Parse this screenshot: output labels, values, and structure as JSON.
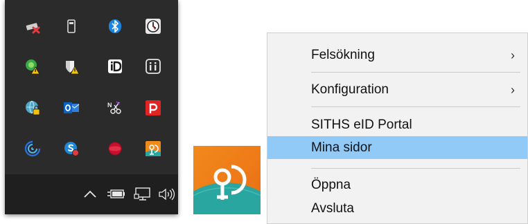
{
  "tray": {
    "icons": [
      {
        "name": "safely-remove-drive-icon"
      },
      {
        "name": "usb-drive-icon"
      },
      {
        "name": "bluetooth-icon"
      },
      {
        "name": "clock-app-icon"
      },
      {
        "name": "security-warning-icon"
      },
      {
        "name": "defender-warning-icon"
      },
      {
        "name": "id-app-icon"
      },
      {
        "name": "info-app-icon"
      },
      {
        "name": "vpn-lock-icon"
      },
      {
        "name": "outlook-icon"
      },
      {
        "name": "snipping-tool-icon"
      },
      {
        "name": "p-app-icon"
      },
      {
        "name": "swirl-app-icon"
      },
      {
        "name": "skype-icon"
      },
      {
        "name": "red-ball-icon"
      },
      {
        "name": "sithsid-tray-icon"
      }
    ]
  },
  "taskbar": {
    "items": [
      "show-hidden-icons-chevron-icon",
      "power-battery-icon",
      "network-icon",
      "speaker-volume-icon"
    ]
  },
  "menu": {
    "items": [
      {
        "label": "Felsökning",
        "submenu": true,
        "arrow": "›"
      },
      {
        "label": "Konfiguration",
        "submenu": true,
        "arrow": "›"
      },
      {
        "label": "SITHS eID Portal",
        "submenu": false
      },
      {
        "label": "Mina sidor",
        "submenu": false,
        "highlighted": true
      },
      {
        "label": "Öppna",
        "submenu": false
      },
      {
        "label": "Avsluta",
        "submenu": false
      }
    ]
  },
  "colors": {
    "tray_bg": "#2b2b2b",
    "taskbar_bg": "#1f1f1f",
    "menu_bg": "#f2f2f2",
    "menu_highlight": "#91c9f7",
    "tile_orange": "#f28a1b",
    "tile_teal": "#2aa6a0"
  }
}
